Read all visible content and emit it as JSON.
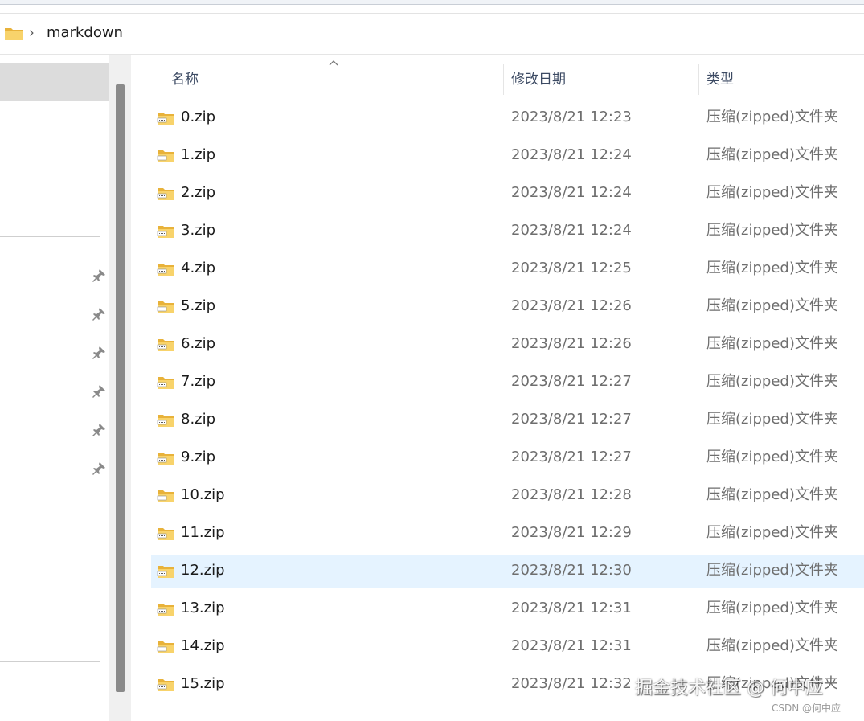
{
  "address_bar": {
    "path_segments": [
      "markdown"
    ],
    "folder_icon": "folder-icon",
    "separator_icon": "chevron-right-icon"
  },
  "columns": {
    "name": "名称",
    "modified": "修改日期",
    "type": "类型",
    "sort_indicator": "sort-ascending-icon"
  },
  "files": [
    {
      "name": "0.zip",
      "modified": "2023/8/21 12:23",
      "type": "压缩(zipped)文件夹"
    },
    {
      "name": "1.zip",
      "modified": "2023/8/21 12:24",
      "type": "压缩(zipped)文件夹"
    },
    {
      "name": "2.zip",
      "modified": "2023/8/21 12:24",
      "type": "压缩(zipped)文件夹"
    },
    {
      "name": "3.zip",
      "modified": "2023/8/21 12:24",
      "type": "压缩(zipped)文件夹"
    },
    {
      "name": "4.zip",
      "modified": "2023/8/21 12:25",
      "type": "压缩(zipped)文件夹"
    },
    {
      "name": "5.zip",
      "modified": "2023/8/21 12:26",
      "type": "压缩(zipped)文件夹"
    },
    {
      "name": "6.zip",
      "modified": "2023/8/21 12:26",
      "type": "压缩(zipped)文件夹"
    },
    {
      "name": "7.zip",
      "modified": "2023/8/21 12:27",
      "type": "压缩(zipped)文件夹"
    },
    {
      "name": "8.zip",
      "modified": "2023/8/21 12:27",
      "type": "压缩(zipped)文件夹"
    },
    {
      "name": "9.zip",
      "modified": "2023/8/21 12:27",
      "type": "压缩(zipped)文件夹"
    },
    {
      "name": "10.zip",
      "modified": "2023/8/21 12:28",
      "type": "压缩(zipped)文件夹"
    },
    {
      "name": "11.zip",
      "modified": "2023/8/21 12:29",
      "type": "压缩(zipped)文件夹"
    },
    {
      "name": "12.zip",
      "modified": "2023/8/21 12:30",
      "type": "压缩(zipped)文件夹",
      "selected": true
    },
    {
      "name": "13.zip",
      "modified": "2023/8/21 12:31",
      "type": "压缩(zipped)文件夹"
    },
    {
      "name": "14.zip",
      "modified": "2023/8/21 12:31",
      "type": "压缩(zipped)文件夹"
    },
    {
      "name": "15.zip",
      "modified": "2023/8/21 12:32",
      "type": "压缩(zipped)文件夹"
    }
  ],
  "watermark": {
    "main": "掘金技术社区 @ 何中应",
    "small": "CSDN @何中应"
  },
  "colors": {
    "selected_row": "#e5f3ff",
    "nav_selected": "#dcdcdc",
    "header_text": "#3c4a63",
    "secondary_text": "#6e6e6e",
    "folder_yellow": "#f4c542"
  }
}
